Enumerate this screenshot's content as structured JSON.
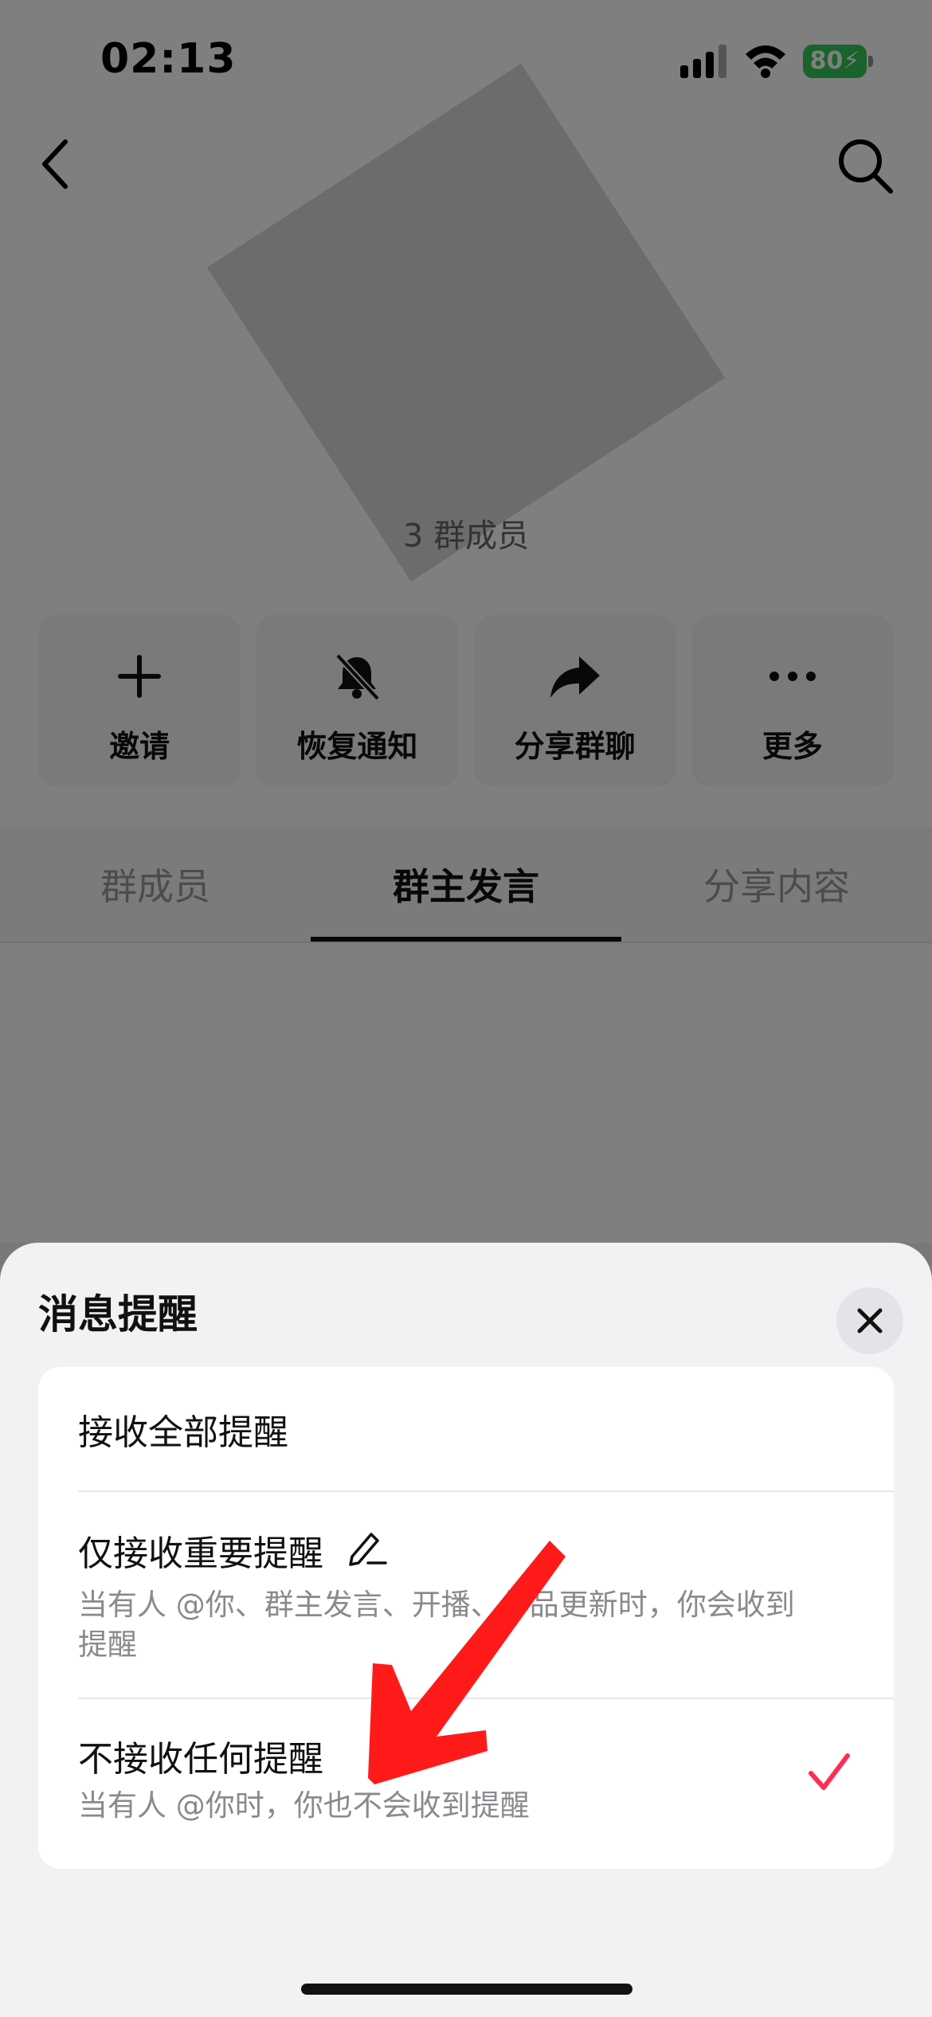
{
  "status_bar": {
    "time": "02:13",
    "battery": "80"
  },
  "group": {
    "member_count_text": "3  群成员"
  },
  "actions": [
    {
      "label": "邀请",
      "icon": "plus-icon"
    },
    {
      "label": "恢复通知",
      "icon": "bell-slash-icon"
    },
    {
      "label": "分享群聊",
      "icon": "share-arrow-icon"
    },
    {
      "label": "更多",
      "icon": "more-dots-icon"
    }
  ],
  "tabs": [
    {
      "label": "群成员",
      "active": false
    },
    {
      "label": "群主发言",
      "active": true
    },
    {
      "label": "分享内容",
      "active": false
    }
  ],
  "sheet": {
    "title": "消息提醒",
    "options": [
      {
        "title": "接收全部提醒",
        "desc": ""
      },
      {
        "title": "仅接收重要提醒",
        "desc": "当有人 @你、群主发言、开播、作品更新时，你会收到提醒"
      },
      {
        "title": "不接收任何提醒",
        "desc": "当有人 @你时，你也不会收到提醒",
        "selected": true
      }
    ]
  },
  "colors": {
    "accent": "#fe2c55",
    "battery": "#34c759",
    "annotation_arrow": "#ff1a1a"
  }
}
